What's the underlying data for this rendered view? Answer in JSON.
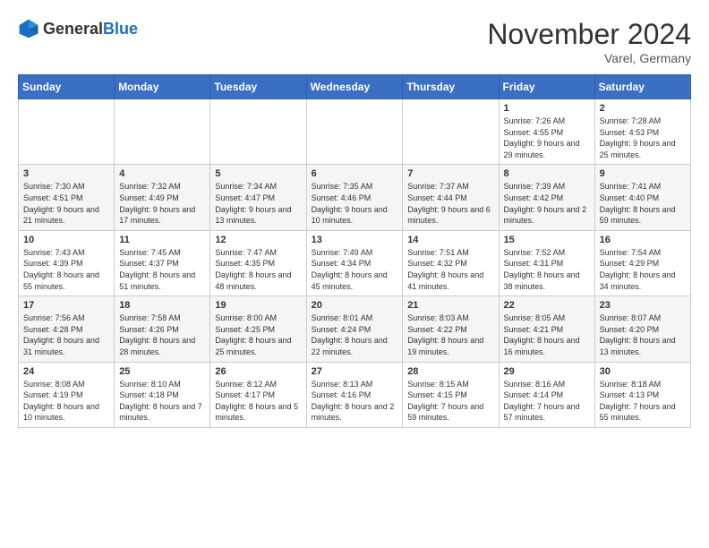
{
  "header": {
    "logo_general": "General",
    "logo_blue": "Blue",
    "month_title": "November 2024",
    "location": "Varel, Germany"
  },
  "weekdays": [
    "Sunday",
    "Monday",
    "Tuesday",
    "Wednesday",
    "Thursday",
    "Friday",
    "Saturday"
  ],
  "weeks": [
    [
      {
        "day": "",
        "sunrise": "",
        "sunset": "",
        "daylight": ""
      },
      {
        "day": "",
        "sunrise": "",
        "sunset": "",
        "daylight": ""
      },
      {
        "day": "",
        "sunrise": "",
        "sunset": "",
        "daylight": ""
      },
      {
        "day": "",
        "sunrise": "",
        "sunset": "",
        "daylight": ""
      },
      {
        "day": "",
        "sunrise": "",
        "sunset": "",
        "daylight": ""
      },
      {
        "day": "1",
        "sunrise": "Sunrise: 7:26 AM",
        "sunset": "Sunset: 4:55 PM",
        "daylight": "Daylight: 9 hours and 29 minutes."
      },
      {
        "day": "2",
        "sunrise": "Sunrise: 7:28 AM",
        "sunset": "Sunset: 4:53 PM",
        "daylight": "Daylight: 9 hours and 25 minutes."
      }
    ],
    [
      {
        "day": "3",
        "sunrise": "Sunrise: 7:30 AM",
        "sunset": "Sunset: 4:51 PM",
        "daylight": "Daylight: 9 hours and 21 minutes."
      },
      {
        "day": "4",
        "sunrise": "Sunrise: 7:32 AM",
        "sunset": "Sunset: 4:49 PM",
        "daylight": "Daylight: 9 hours and 17 minutes."
      },
      {
        "day": "5",
        "sunrise": "Sunrise: 7:34 AM",
        "sunset": "Sunset: 4:47 PM",
        "daylight": "Daylight: 9 hours and 13 minutes."
      },
      {
        "day": "6",
        "sunrise": "Sunrise: 7:35 AM",
        "sunset": "Sunset: 4:46 PM",
        "daylight": "Daylight: 9 hours and 10 minutes."
      },
      {
        "day": "7",
        "sunrise": "Sunrise: 7:37 AM",
        "sunset": "Sunset: 4:44 PM",
        "daylight": "Daylight: 9 hours and 6 minutes."
      },
      {
        "day": "8",
        "sunrise": "Sunrise: 7:39 AM",
        "sunset": "Sunset: 4:42 PM",
        "daylight": "Daylight: 9 hours and 2 minutes."
      },
      {
        "day": "9",
        "sunrise": "Sunrise: 7:41 AM",
        "sunset": "Sunset: 4:40 PM",
        "daylight": "Daylight: 8 hours and 59 minutes."
      }
    ],
    [
      {
        "day": "10",
        "sunrise": "Sunrise: 7:43 AM",
        "sunset": "Sunset: 4:39 PM",
        "daylight": "Daylight: 8 hours and 55 minutes."
      },
      {
        "day": "11",
        "sunrise": "Sunrise: 7:45 AM",
        "sunset": "Sunset: 4:37 PM",
        "daylight": "Daylight: 8 hours and 51 minutes."
      },
      {
        "day": "12",
        "sunrise": "Sunrise: 7:47 AM",
        "sunset": "Sunset: 4:35 PM",
        "daylight": "Daylight: 8 hours and 48 minutes."
      },
      {
        "day": "13",
        "sunrise": "Sunrise: 7:49 AM",
        "sunset": "Sunset: 4:34 PM",
        "daylight": "Daylight: 8 hours and 45 minutes."
      },
      {
        "day": "14",
        "sunrise": "Sunrise: 7:51 AM",
        "sunset": "Sunset: 4:32 PM",
        "daylight": "Daylight: 8 hours and 41 minutes."
      },
      {
        "day": "15",
        "sunrise": "Sunrise: 7:52 AM",
        "sunset": "Sunset: 4:31 PM",
        "daylight": "Daylight: 8 hours and 38 minutes."
      },
      {
        "day": "16",
        "sunrise": "Sunrise: 7:54 AM",
        "sunset": "Sunset: 4:29 PM",
        "daylight": "Daylight: 8 hours and 34 minutes."
      }
    ],
    [
      {
        "day": "17",
        "sunrise": "Sunrise: 7:56 AM",
        "sunset": "Sunset: 4:28 PM",
        "daylight": "Daylight: 8 hours and 31 minutes."
      },
      {
        "day": "18",
        "sunrise": "Sunrise: 7:58 AM",
        "sunset": "Sunset: 4:26 PM",
        "daylight": "Daylight: 8 hours and 28 minutes."
      },
      {
        "day": "19",
        "sunrise": "Sunrise: 8:00 AM",
        "sunset": "Sunset: 4:25 PM",
        "daylight": "Daylight: 8 hours and 25 minutes."
      },
      {
        "day": "20",
        "sunrise": "Sunrise: 8:01 AM",
        "sunset": "Sunset: 4:24 PM",
        "daylight": "Daylight: 8 hours and 22 minutes."
      },
      {
        "day": "21",
        "sunrise": "Sunrise: 8:03 AM",
        "sunset": "Sunset: 4:22 PM",
        "daylight": "Daylight: 8 hours and 19 minutes."
      },
      {
        "day": "22",
        "sunrise": "Sunrise: 8:05 AM",
        "sunset": "Sunset: 4:21 PM",
        "daylight": "Daylight: 8 hours and 16 minutes."
      },
      {
        "day": "23",
        "sunrise": "Sunrise: 8:07 AM",
        "sunset": "Sunset: 4:20 PM",
        "daylight": "Daylight: 8 hours and 13 minutes."
      }
    ],
    [
      {
        "day": "24",
        "sunrise": "Sunrise: 8:08 AM",
        "sunset": "Sunset: 4:19 PM",
        "daylight": "Daylight: 8 hours and 10 minutes."
      },
      {
        "day": "25",
        "sunrise": "Sunrise: 8:10 AM",
        "sunset": "Sunset: 4:18 PM",
        "daylight": "Daylight: 8 hours and 7 minutes."
      },
      {
        "day": "26",
        "sunrise": "Sunrise: 8:12 AM",
        "sunset": "Sunset: 4:17 PM",
        "daylight": "Daylight: 8 hours and 5 minutes."
      },
      {
        "day": "27",
        "sunrise": "Sunrise: 8:13 AM",
        "sunset": "Sunset: 4:16 PM",
        "daylight": "Daylight: 8 hours and 2 minutes."
      },
      {
        "day": "28",
        "sunrise": "Sunrise: 8:15 AM",
        "sunset": "Sunset: 4:15 PM",
        "daylight": "Daylight: 7 hours and 59 minutes."
      },
      {
        "day": "29",
        "sunrise": "Sunrise: 8:16 AM",
        "sunset": "Sunset: 4:14 PM",
        "daylight": "Daylight: 7 hours and 57 minutes."
      },
      {
        "day": "30",
        "sunrise": "Sunrise: 8:18 AM",
        "sunset": "Sunset: 4:13 PM",
        "daylight": "Daylight: 7 hours and 55 minutes."
      }
    ]
  ]
}
